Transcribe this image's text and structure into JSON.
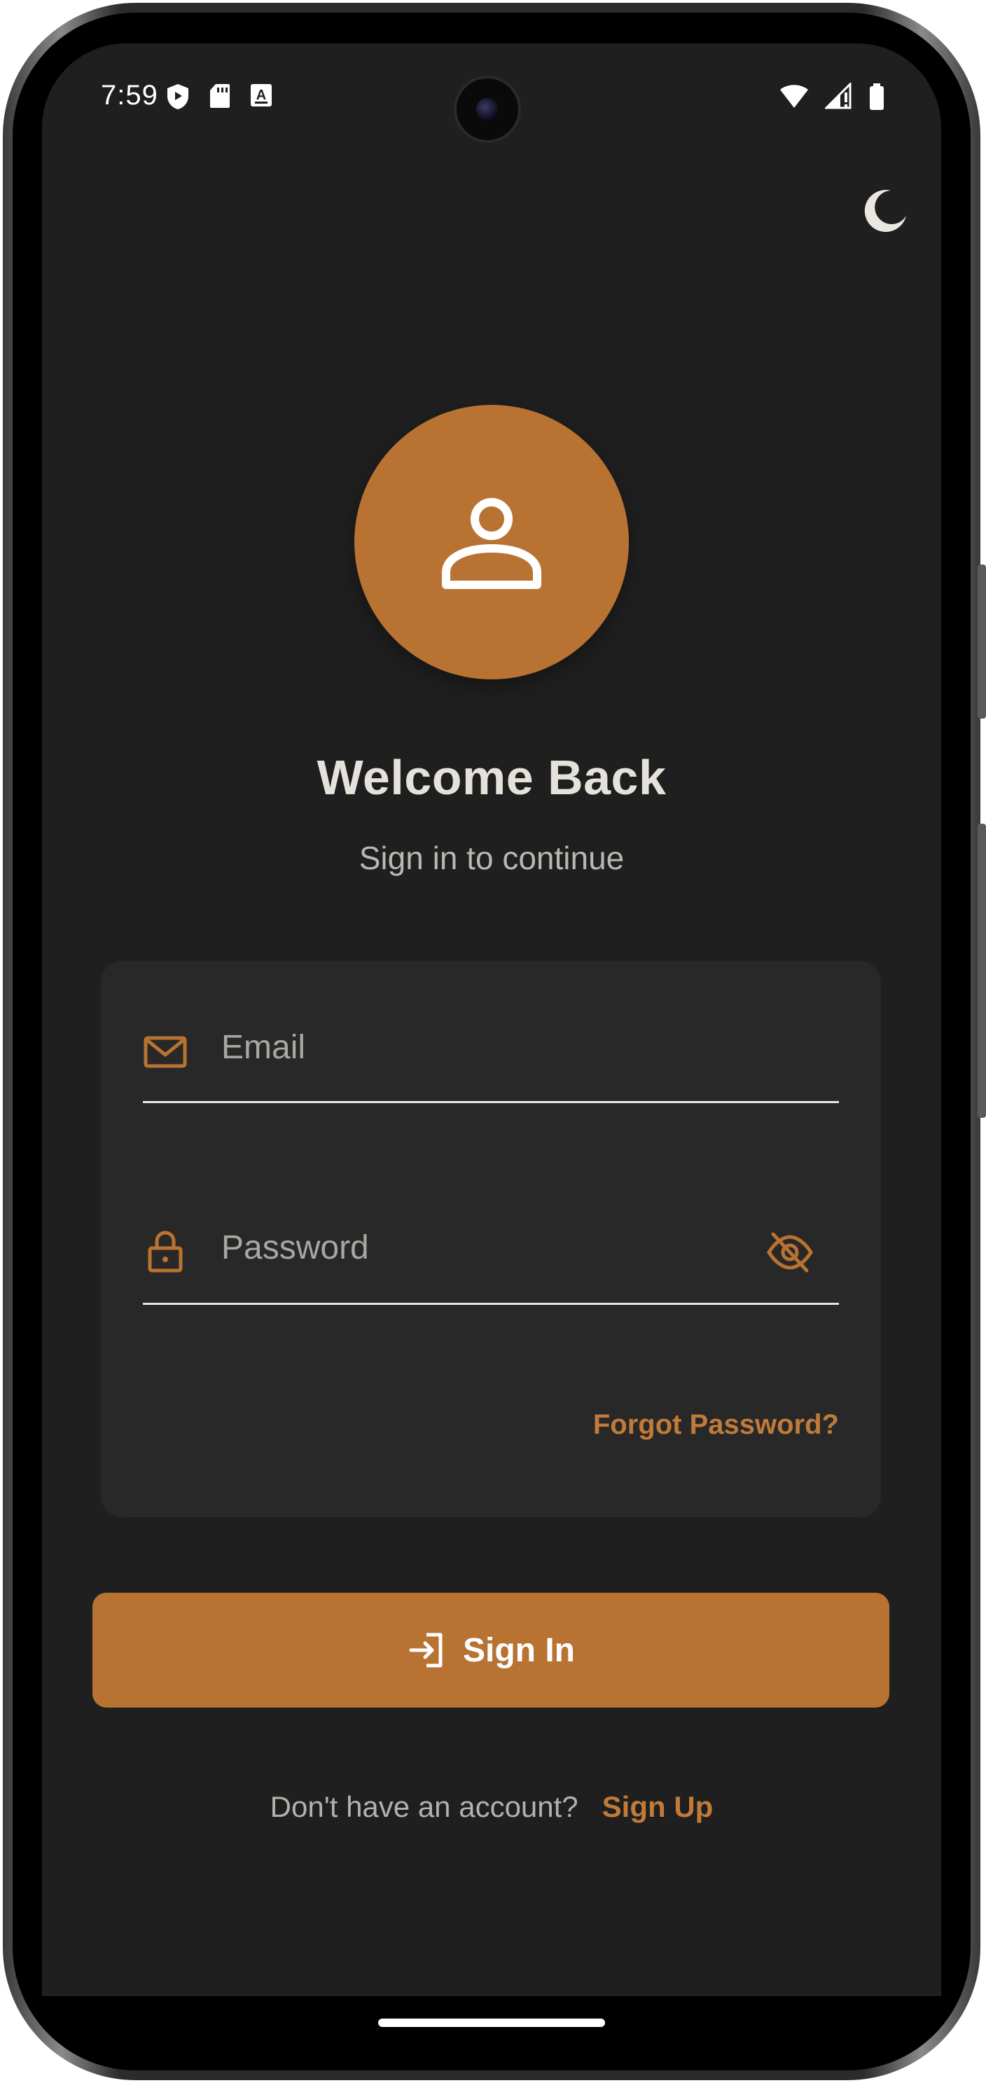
{
  "status_bar": {
    "time": "7:59",
    "left_icons": [
      "shield-icon",
      "sd-card-icon",
      "keyboard-a-icon"
    ],
    "right_icons": [
      "wifi-icon",
      "signal-icon",
      "battery-icon"
    ]
  },
  "theme_toggle": {
    "icon": "moon-icon"
  },
  "avatar": {
    "icon": "person-icon"
  },
  "header": {
    "title": "Welcome Back",
    "subtitle": "Sign in to continue"
  },
  "form": {
    "email": {
      "placeholder": "Email",
      "value": "",
      "icon": "mail-icon"
    },
    "password": {
      "placeholder": "Password",
      "value": "",
      "icon": "lock-icon",
      "toggle_icon": "eye-off-icon"
    },
    "forgot_label": "Forgot Password?"
  },
  "signin_button": {
    "label": "Sign In",
    "icon": "login-icon"
  },
  "signup": {
    "question": "Don't have an account?",
    "link_label": "Sign Up"
  },
  "colors": {
    "accent": "#b87333",
    "background": "#1f1f1f",
    "card": "#282828",
    "text_primary": "#e4e2da",
    "text_secondary": "#b9b7b1"
  }
}
